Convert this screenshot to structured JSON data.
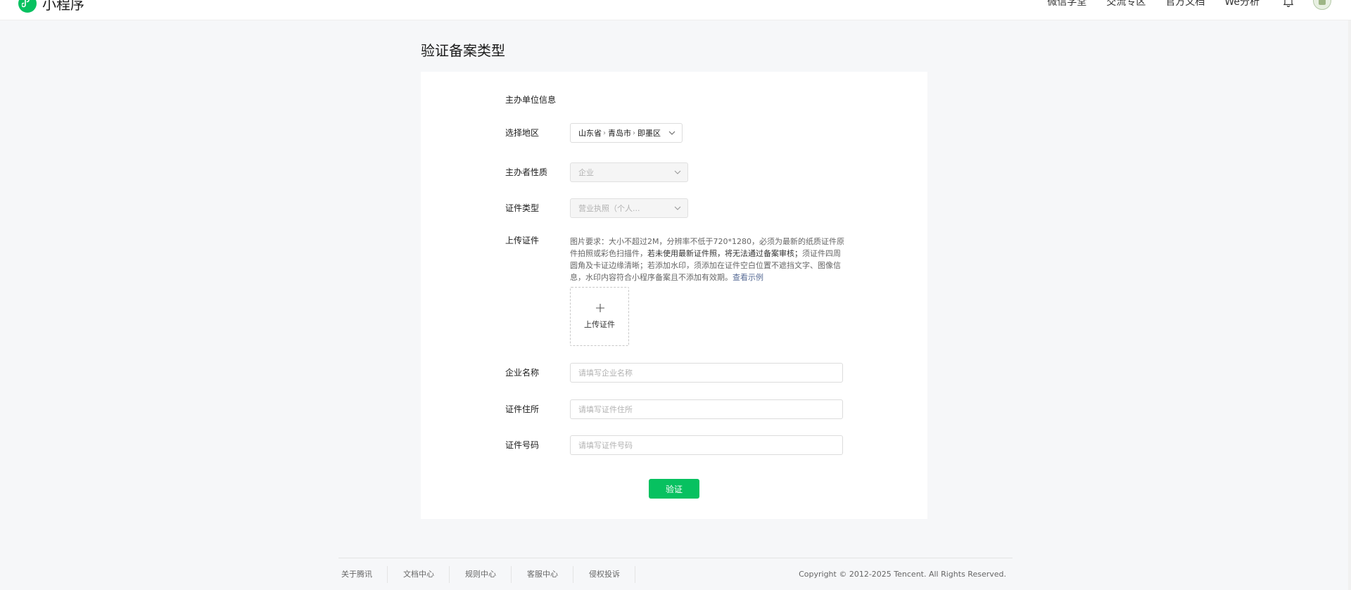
{
  "header": {
    "app_name": "小程序",
    "nav": [
      "微信学堂",
      "交流专区",
      "官方文档",
      "We分析"
    ]
  },
  "page_title": "验证备案类型",
  "form": {
    "section_title": "主办单位信息",
    "region": {
      "label": "选择地区",
      "province": "山东省",
      "city": "青岛市",
      "district": "即墨区"
    },
    "organizer_type": {
      "label": "主办者性质",
      "value": "企业"
    },
    "cert_type": {
      "label": "证件类型",
      "value": "营业执照（个人..."
    },
    "upload": {
      "label": "上传证件",
      "req_part1": "图片要求：大小不超过2M，分辨率不低于720*1280，必须为最新的纸质证件原件拍照或彩色扫描件，",
      "req_bold": "若未使用最新证件照，将无法通过备案审核；",
      "req_part2": "须证件四周圆角及卡证边缘清晰；若添加水印，须添加在证件空白位置不遮挡文字、图像信息，水印内容符合小程序备案且不添加有效期。",
      "example_link": "查看示例",
      "button_text": "上传证件"
    },
    "company_name": {
      "label": "企业名称",
      "placeholder": "请填写企业名称"
    },
    "cert_address": {
      "label": "证件住所",
      "placeholder": "请填写证件住所"
    },
    "cert_number": {
      "label": "证件号码",
      "placeholder": "请填写证件号码"
    },
    "submit_label": "验证"
  },
  "footer": {
    "links": [
      "关于腾讯",
      "文档中心",
      "规则中心",
      "客服中心",
      "侵权投诉"
    ],
    "copyright": "Copyright © 2012-2025 Tencent. All Rights Reserved."
  },
  "colors": {
    "accent": "#07c160",
    "link": "#576b95",
    "page_bg": "#f6f7f9"
  },
  "icons": [
    "miniprogram-logo-icon",
    "bell-icon",
    "chevron-down-icon",
    "plus-icon"
  ]
}
